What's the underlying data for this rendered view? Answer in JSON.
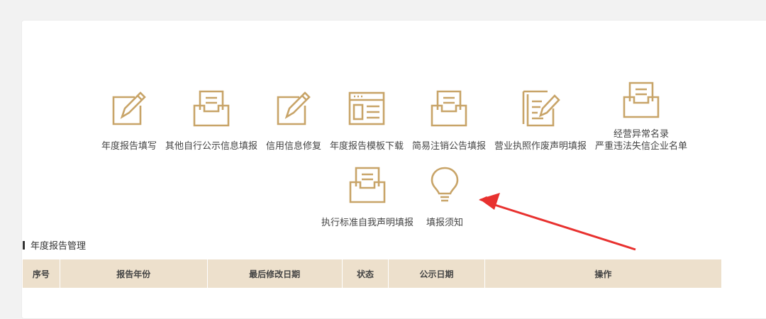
{
  "functions_row1": [
    {
      "label": "年度报告填写",
      "icon": "edit-icon"
    },
    {
      "label": "其他自行公示信息填报",
      "icon": "inbox-document-icon"
    },
    {
      "label": "信用信息修复",
      "icon": "edit-icon"
    },
    {
      "label": "年度报告模板下载",
      "icon": "template-icon"
    },
    {
      "label": "简易注销公告填报",
      "icon": "inbox-document-icon"
    },
    {
      "label": "营业执照作废声明填报",
      "icon": "document-edit-icon"
    },
    {
      "label_lines": [
        "经营异常名录",
        "严重违法失信企业名单"
      ],
      "icon": "inbox-document-icon"
    }
  ],
  "functions_row2": [
    {
      "label": "执行标准自我声明填报",
      "icon": "inbox-document-icon"
    },
    {
      "label": "填报须知",
      "icon": "lightbulb-icon"
    }
  ],
  "section": {
    "title": "年度报告管理"
  },
  "table": {
    "headers": [
      "序号",
      "报告年份",
      "最后修改日期",
      "状态",
      "公示日期",
      "操作"
    ]
  },
  "colors": {
    "icon_gold": "#c8a468",
    "arrow_red": "#e8312f",
    "table_header_bg": "#ede0cc"
  }
}
